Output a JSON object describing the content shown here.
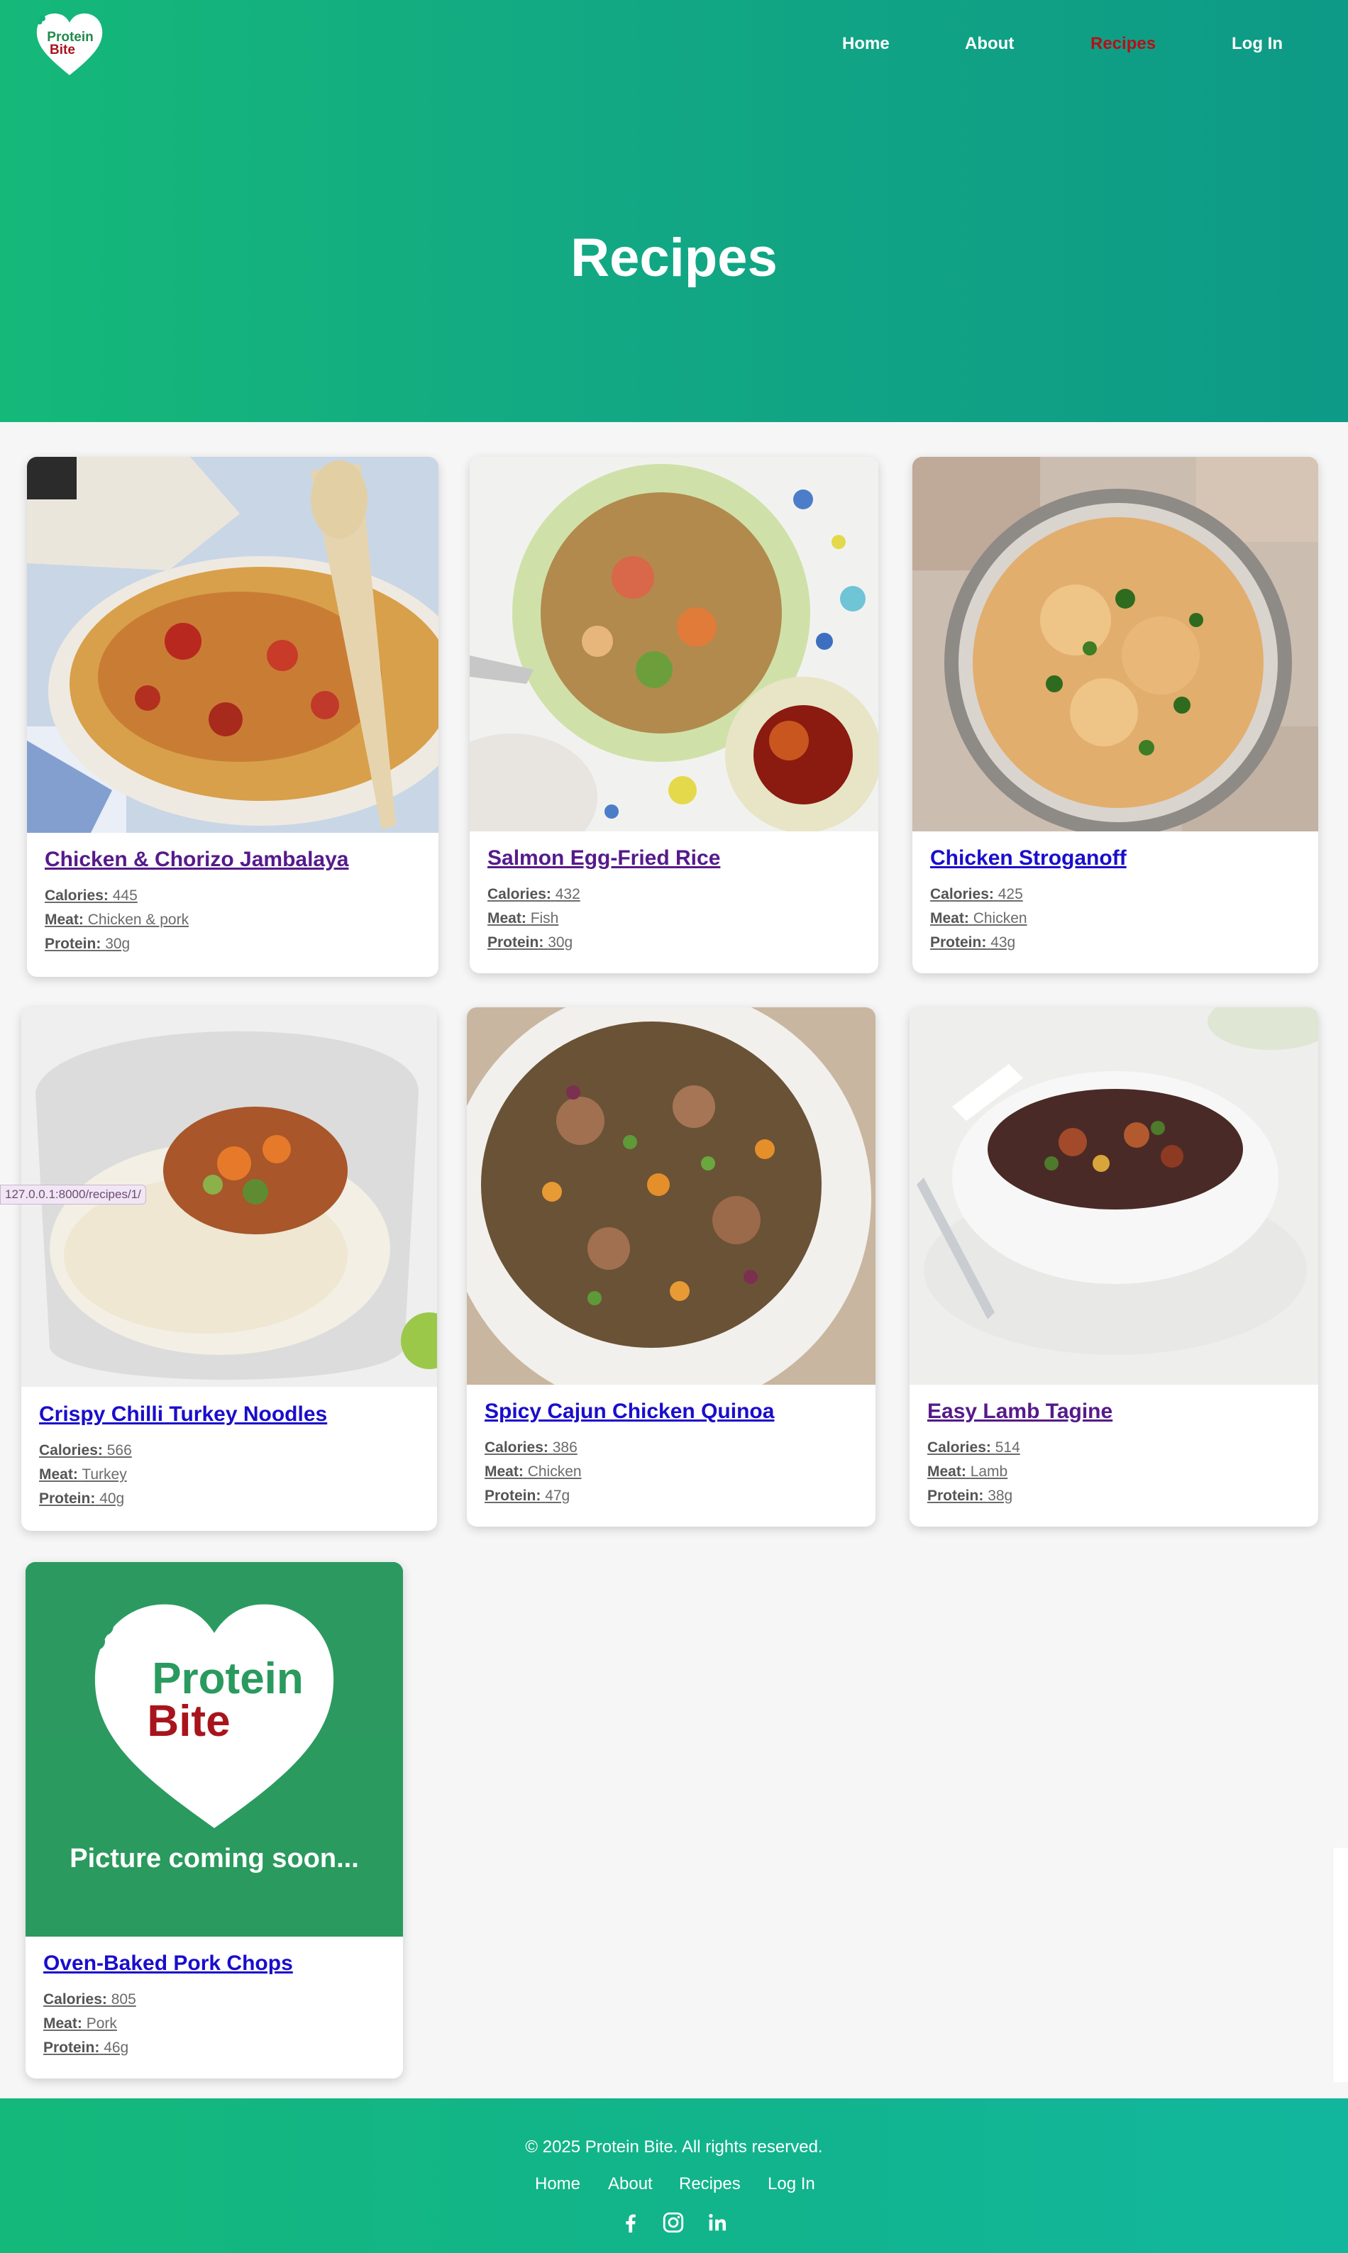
{
  "site": {
    "logo_line1": "Protein",
    "logo_line2": "Bite",
    "nav": [
      {
        "label": "Home"
      },
      {
        "label": "About"
      },
      {
        "label": "Recipes",
        "active": true
      },
      {
        "label": "Log In"
      }
    ],
    "page_title": "Recipes"
  },
  "fact_labels": {
    "calories": "Calories:",
    "meat": "Meat:",
    "protein": "Protein:"
  },
  "recipes": [
    {
      "title": "Chicken & Chorizo Jambalaya",
      "calories": "445",
      "meat": "Chicken & pork",
      "protein": "30g",
      "visited": true,
      "image": "jambalaya-photo"
    },
    {
      "title": "Salmon Egg-Fried Rice",
      "calories": "432",
      "meat": "Fish",
      "protein": "30g",
      "visited": true,
      "image": "salmon-rice-photo"
    },
    {
      "title": "Chicken Stroganoff",
      "calories": "425",
      "meat": "Chicken",
      "protein": "43g",
      "visited": false,
      "image": "stroganoff-photo"
    },
    {
      "title": "Crispy Chilli Turkey Noodles",
      "calories": "566",
      "meat": "Turkey",
      "protein": "40g",
      "visited": false,
      "image": "turkey-noodles-photo"
    },
    {
      "title": "Spicy Cajun Chicken Quinoa",
      "calories": "386",
      "meat": "Chicken",
      "protein": "47g",
      "visited": false,
      "image": "cajun-quinoa-photo"
    },
    {
      "title": "Easy Lamb Tagine",
      "calories": "514",
      "meat": "Lamb",
      "protein": "38g",
      "visited": true,
      "image": "lamb-tagine-photo"
    },
    {
      "title": "Oven-Baked Pork Chops",
      "calories": "805",
      "meat": "Pork",
      "protein": "46g",
      "visited": false,
      "image": "placeholder-logo"
    }
  ],
  "placeholder": {
    "line1": "Protein",
    "line2": "Bite",
    "caption": "Picture coming soon..."
  },
  "status_url": "127.0.0.1:8000/recipes/1/",
  "footer": {
    "copyright": "© 2025 Protein Bite. All rights reserved.",
    "links": [
      {
        "label": "Home"
      },
      {
        "label": "About"
      },
      {
        "label": "Recipes"
      },
      {
        "label": "Log In"
      }
    ],
    "social": [
      "facebook-icon",
      "instagram-icon",
      "linkedin-icon"
    ]
  },
  "colors": {
    "brand_green": "#15b879",
    "brand_teal": "#0d9a86",
    "active_nav": "#b5101a",
    "link_visited": "#551a8b",
    "link_fresh": "#1a0dcc",
    "placeholder_green": "#2a9a5e",
    "logo_red": "#a8141c"
  }
}
